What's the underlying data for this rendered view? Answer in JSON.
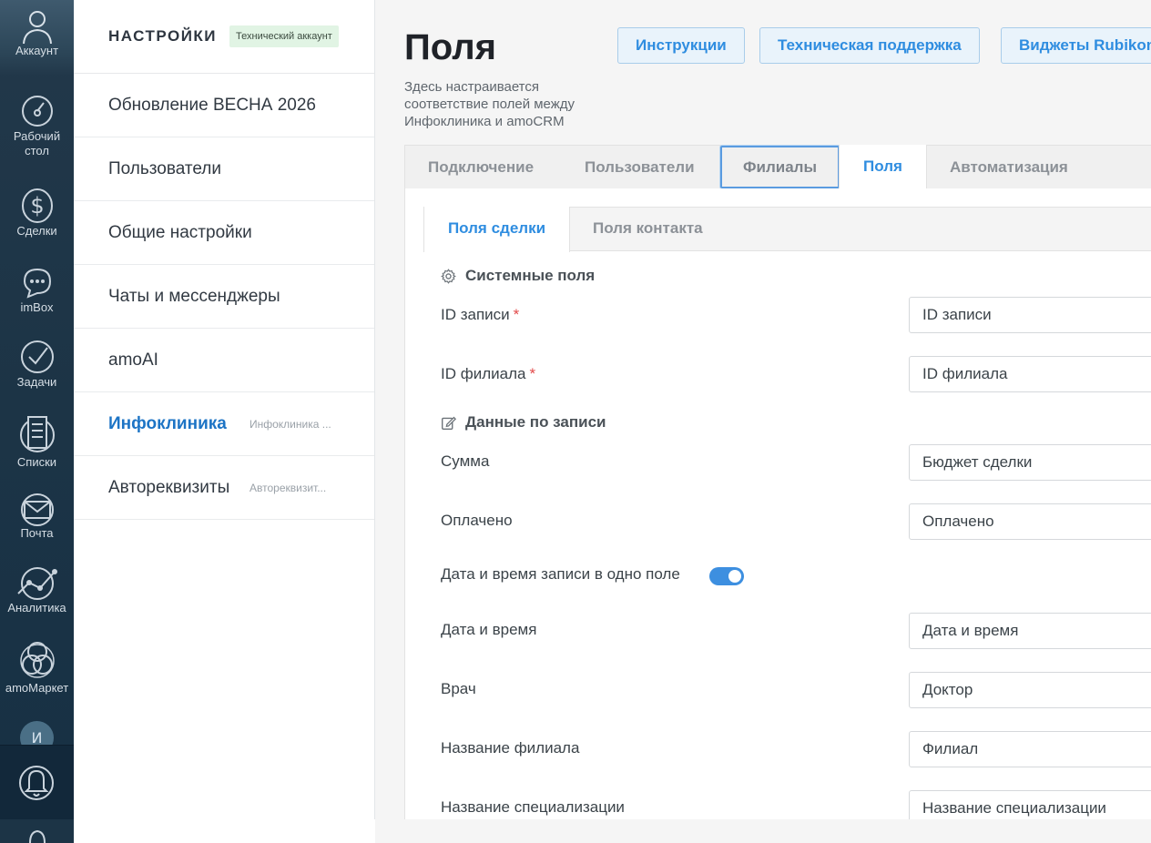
{
  "rail": {
    "items": [
      {
        "label": "Аккаунт",
        "icon": "user-icon"
      },
      {
        "label": "Рабочий стол",
        "icon": "dashboard-icon"
      },
      {
        "label": "Сделки",
        "icon": "dollar-icon"
      },
      {
        "label": "imBox",
        "icon": "chat-bubble-icon"
      },
      {
        "label": "Задачи",
        "icon": "checkmark-circle-icon"
      },
      {
        "label": "Списки",
        "icon": "list-icon"
      },
      {
        "label": "Почта",
        "icon": "envelope-icon"
      },
      {
        "label": "Аналитика",
        "icon": "chart-line-icon"
      },
      {
        "label": "amoМаркет",
        "icon": "market-icon"
      }
    ],
    "avatar_letter": "И",
    "notifications_icon": "bell-icon"
  },
  "sidebar": {
    "title": "НАСТРОЙКИ",
    "badge": "Технический аккаунт",
    "items": [
      {
        "label": "Обновление ВЕСНА 2026",
        "sub": ""
      },
      {
        "label": "Пользователи",
        "sub": ""
      },
      {
        "label": "Общие настройки",
        "sub": ""
      },
      {
        "label": "Чаты и мессенджеры",
        "sub": ""
      },
      {
        "label": "amoAI",
        "sub": ""
      },
      {
        "label": "Инфоклиника",
        "sub": "Инфоклиника ..."
      },
      {
        "label": "Автореквизиты",
        "sub": "Автореквизит..."
      }
    ]
  },
  "header": {
    "title": "Поля",
    "description": "Здесь настраивается соответствие полей между Инфоклиника и amoCRM",
    "buttons": [
      "Инструкции",
      "Техническая поддержка",
      "Виджеты Rubikom"
    ]
  },
  "tabs": [
    "Подключение",
    "Пользователи",
    "Филиалы",
    "Поля",
    "Автоматизация"
  ],
  "subtabs": [
    "Поля сделки",
    "Поля контакта"
  ],
  "sections": {
    "system": "Системные поля",
    "record": "Данные по записи"
  },
  "fields": {
    "record_id": {
      "label": "ID записи",
      "value": "ID записи",
      "required": "*"
    },
    "branch_id": {
      "label": "ID филиала",
      "value": "ID филиала",
      "required": "*"
    },
    "sum": {
      "label": "Сумма",
      "value": "Бюджет сделки"
    },
    "paid": {
      "label": "Оплачено",
      "value": "Оплачено"
    },
    "datetime_toggle": {
      "label": "Дата и время записи в одно поле",
      "on": true
    },
    "datetime": {
      "label": "Дата и время",
      "value": "Дата и время"
    },
    "doctor": {
      "label": "Врач",
      "value": "Доктор"
    },
    "branch_name": {
      "label": "Название филиала",
      "value": "Филиал"
    },
    "specialization": {
      "label": "Название специализации",
      "value": "Название специализации"
    }
  },
  "colors": {
    "accent": "#2f8de0",
    "active_sidebar": "#1d74c5",
    "required": "#e24a4a",
    "rail": "#1c3446"
  }
}
